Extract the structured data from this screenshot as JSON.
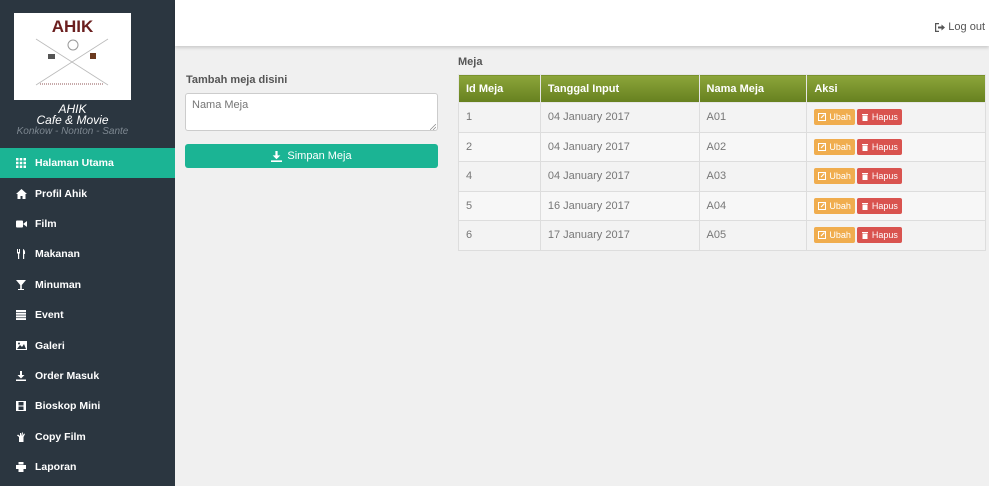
{
  "sidebar": {
    "logo_text": "AHIK",
    "brand_name": "AHIK",
    "brand_sub": "Cafe & Movie",
    "brand_tagline": "Konkow - Nonton - Sante",
    "items": [
      {
        "label": "Halaman Utama",
        "icon": "grid-icon",
        "active": true
      },
      {
        "label": "Profil Ahik",
        "icon": "home-icon"
      },
      {
        "label": "Film",
        "icon": "video-camera-icon"
      },
      {
        "label": "Makanan",
        "icon": "cutlery-icon"
      },
      {
        "label": "Minuman",
        "icon": "glass-icon"
      },
      {
        "label": "Event",
        "icon": "list-icon"
      },
      {
        "label": "Galeri",
        "icon": "picture-icon"
      },
      {
        "label": "Order Masuk",
        "icon": "download-icon"
      },
      {
        "label": "Bioskop Mini",
        "icon": "film-icon"
      },
      {
        "label": "Copy Film",
        "icon": "hand-icon"
      },
      {
        "label": "Laporan",
        "icon": "print-icon"
      }
    ]
  },
  "topbar": {
    "logout_label": "Log out",
    "logout_icon": "logout-icon"
  },
  "form": {
    "label": "Tambah meja disini",
    "placeholder": "Nama Meja",
    "submit_label": "Simpan Meja",
    "submit_icon": "download-icon"
  },
  "table": {
    "title": "Meja",
    "columns": [
      "Id Meja",
      "Tanggal Input",
      "Nama Meja",
      "Aksi"
    ],
    "rows": [
      {
        "id": "1",
        "date": "04 January 2017",
        "name": "A01"
      },
      {
        "id": "2",
        "date": "04 January 2017",
        "name": "A02"
      },
      {
        "id": "4",
        "date": "04 January 2017",
        "name": "A03"
      },
      {
        "id": "5",
        "date": "16 January 2017",
        "name": "A04"
      },
      {
        "id": "6",
        "date": "17 January 2017",
        "name": "A05"
      }
    ],
    "edit_label": "Ubah",
    "delete_label": "Hapus"
  },
  "colors": {
    "sidebar_bg": "#2b3640",
    "accent": "#1bb494",
    "table_header": "#7c9530",
    "edit_button": "#f0ad4e",
    "delete_button": "#d9534f"
  }
}
